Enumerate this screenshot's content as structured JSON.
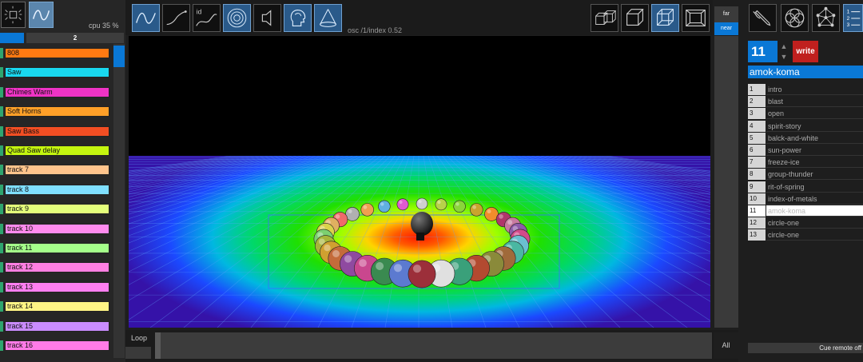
{
  "left": {
    "cpu_label": "cpu 35 %",
    "tab_label": "2",
    "tracks": [
      {
        "label": "808",
        "color": "#ff7a12",
        "mark": "#2fa56f"
      },
      {
        "label": "Saw",
        "color": "#19d8ef",
        "mark": "#2fa56f"
      },
      {
        "label": "Chimes Warm",
        "color": "#ef33c5",
        "mark": "#2fa56f"
      },
      {
        "label": "Soft Horns",
        "color": "#ffa028",
        "mark": "#2fa56f"
      },
      {
        "label": "Saw Bass",
        "color": "#f24e23",
        "mark": "#2fa56f"
      },
      {
        "label": "Quad Saw delay",
        "color": "#c4f50f",
        "mark": "#2fa56f"
      },
      {
        "label": "track 7",
        "color": "#ffc48c",
        "mark": "#2fa56f"
      },
      {
        "label": "track 8",
        "color": "#7fdfff",
        "mark": "#2fa56f"
      },
      {
        "label": "track 9",
        "color": "#e4ff7b",
        "mark": "#2fa56f"
      },
      {
        "label": "track 10",
        "color": "#ff8bee",
        "mark": "#2fa56f"
      },
      {
        "label": "track 11",
        "color": "#a5ff8a",
        "mark": "#2fa56f"
      },
      {
        "label": "track 12",
        "color": "#ff7fe2",
        "mark": "#2fa56f"
      },
      {
        "label": "track 13",
        "color": "#ff7ff1",
        "mark": "#2fa56f"
      },
      {
        "label": "track 14",
        "color": "#fff585",
        "mark": "#2fa56f"
      },
      {
        "label": "track 15",
        "color": "#c98cff",
        "mark": "#2fa56f"
      },
      {
        "label": "track 16",
        "color": "#ff7be7",
        "mark": "#2fa56f"
      }
    ]
  },
  "toolbar": {
    "osc_text": "osc /1/index 0.52",
    "id_label": "id"
  },
  "depth": {
    "far_label": "far",
    "near_label": "near"
  },
  "bottom": {
    "loop_label": "Loop",
    "all_label": "All"
  },
  "presets": {
    "number": "11",
    "write_label": "write",
    "title": "amok-koma",
    "selected_index": 10,
    "up_arrow": "▲",
    "down_arrow": "▼",
    "items": [
      {
        "num": "1",
        "name": "intro"
      },
      {
        "num": "2",
        "name": "blast"
      },
      {
        "num": "3",
        "name": "open"
      },
      {
        "num": "4",
        "name": "spirit-story"
      },
      {
        "num": "5",
        "name": "balck-and-white"
      },
      {
        "num": "6",
        "name": "sun-power"
      },
      {
        "num": "7",
        "name": "freeze-ice"
      },
      {
        "num": "8",
        "name": "group-thunder"
      },
      {
        "num": "9",
        "name": "rit-of-spring"
      },
      {
        "num": "10",
        "name": "index-of-metals"
      },
      {
        "num": "11",
        "name": "amok-koma"
      },
      {
        "num": "12",
        "name": "circle-one"
      },
      {
        "num": "13",
        "name": "circle-one"
      }
    ],
    "cue_label": "Cue remote off"
  },
  "right_icons": [
    {
      "name": "pen-icon"
    },
    {
      "name": "flower-icon"
    },
    {
      "name": "network-icon"
    },
    {
      "name": "list-icon",
      "text": [
        "1",
        "2",
        "3"
      ]
    }
  ]
}
